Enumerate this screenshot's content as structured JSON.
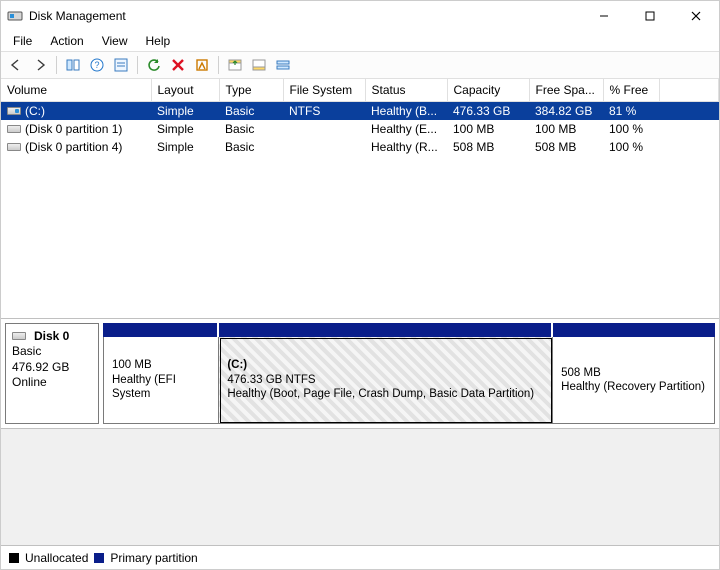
{
  "window": {
    "title": "Disk Management"
  },
  "menu": {
    "file": "File",
    "action": "Action",
    "view": "View",
    "help": "Help"
  },
  "columns": {
    "volume": "Volume",
    "layout": "Layout",
    "type": "Type",
    "fs": "File System",
    "status": "Status",
    "capacity": "Capacity",
    "freespace": "Free Spa...",
    "pctfree": "% Free"
  },
  "volumes": [
    {
      "name": "(C:)",
      "layout": "Simple",
      "type": "Basic",
      "fs": "NTFS",
      "status": "Healthy (B...",
      "capacity": "476.33 GB",
      "free": "384.82 GB",
      "pct": "81 %",
      "selected": true,
      "driveC": true
    },
    {
      "name": "(Disk 0 partition 1)",
      "layout": "Simple",
      "type": "Basic",
      "fs": "",
      "status": "Healthy (E...",
      "capacity": "100 MB",
      "free": "100 MB",
      "pct": "100 %",
      "selected": false,
      "driveC": false
    },
    {
      "name": "(Disk 0 partition 4)",
      "layout": "Simple",
      "type": "Basic",
      "fs": "",
      "status": "Healthy (R...",
      "capacity": "508 MB",
      "free": "508 MB",
      "pct": "100 %",
      "selected": false,
      "driveC": false
    }
  ],
  "disk": {
    "label": "Disk 0",
    "type": "Basic",
    "size": "476.92 GB",
    "state": "Online"
  },
  "partitions": [
    {
      "title": "",
      "line1": "100 MB",
      "line2": "Healthy (EFI System",
      "widthPx": 115,
      "selected": false
    },
    {
      "title": "(C:)",
      "line1": "476.33 GB NTFS",
      "line2": "Healthy (Boot, Page File, Crash Dump, Basic Data Partition)",
      "widthPx": 330,
      "selected": true
    },
    {
      "title": "",
      "line1": "508 MB",
      "line2": "Healthy (Recovery Partition)",
      "widthPx": 160,
      "selected": false
    }
  ],
  "legend": {
    "unallocated": "Unallocated",
    "primary": "Primary partition"
  }
}
